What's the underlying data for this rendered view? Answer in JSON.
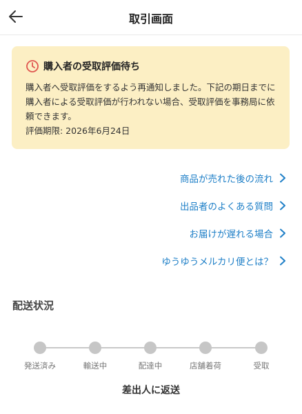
{
  "header": {
    "title": "取引画面",
    "back_icon": "arrow-left-icon"
  },
  "notice": {
    "icon": "clock-icon",
    "title": "購入者の受取評価待ち",
    "body": "購入者へ受取評価をするよう再通知しました。下記の期日までに購入者による受取評価が行われない場合、受取評価を事務局に依頼できます。",
    "deadline": "評価期限: 2026年6月24日",
    "colors": {
      "background": "#fcefc4",
      "icon": "#e0554f"
    }
  },
  "links": [
    {
      "label": "商品が売れた後の流れ"
    },
    {
      "label": "出品者のよくある質問"
    },
    {
      "label": "お届けが遅れる場合"
    },
    {
      "label": "ゆうゆうメルカリ便とは？"
    }
  ],
  "link_color": "#1e7fc7",
  "delivery": {
    "title": "配送状況",
    "steps": [
      {
        "label": "発送済み"
      },
      {
        "label": "輸送中"
      },
      {
        "label": "配達中"
      },
      {
        "label": "店舗着荷"
      },
      {
        "label": "受取"
      }
    ],
    "status_note": "差出人に返送"
  }
}
